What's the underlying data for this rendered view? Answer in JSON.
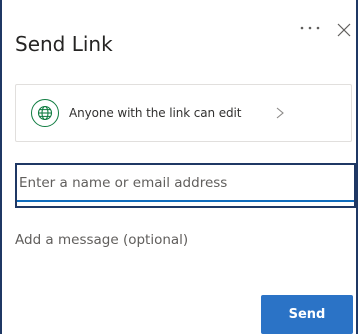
{
  "dialog": {
    "title": "Send Link",
    "more_icon": "more-horizontal-icon",
    "close_icon": "close-icon"
  },
  "link_settings": {
    "icon": "globe-icon",
    "text": "Anyone with the link can edit",
    "chevron_icon": "chevron-right-icon"
  },
  "recipients": {
    "placeholder": "Enter a name or email address",
    "value": ""
  },
  "message": {
    "placeholder": "Add a message (optional)",
    "value": ""
  },
  "actions": {
    "send_label": "Send"
  },
  "colors": {
    "accent": "#2b73c6",
    "focus_border": "#1f3864",
    "globe": "#107c41"
  }
}
